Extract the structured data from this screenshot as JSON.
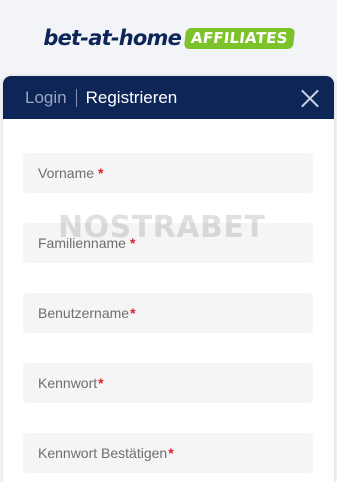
{
  "logo": {
    "brand": "bet-at-home",
    "badge": "AFFILIATES"
  },
  "modal": {
    "tabs": {
      "login": "Login",
      "register": "Registrieren"
    },
    "fields": {
      "first_name": "Vorname",
      "last_name": "Familienname",
      "username": "Benutzername",
      "password": "Kennwort",
      "password_confirm": "Kennwort Bestätigen",
      "required_marker": "*"
    }
  },
  "watermark": "NOSTRABET",
  "colors": {
    "navy": "#0d2557",
    "green": "#7cc22a",
    "required": "#d8232a"
  },
  "icons": {
    "close": "close-icon"
  }
}
